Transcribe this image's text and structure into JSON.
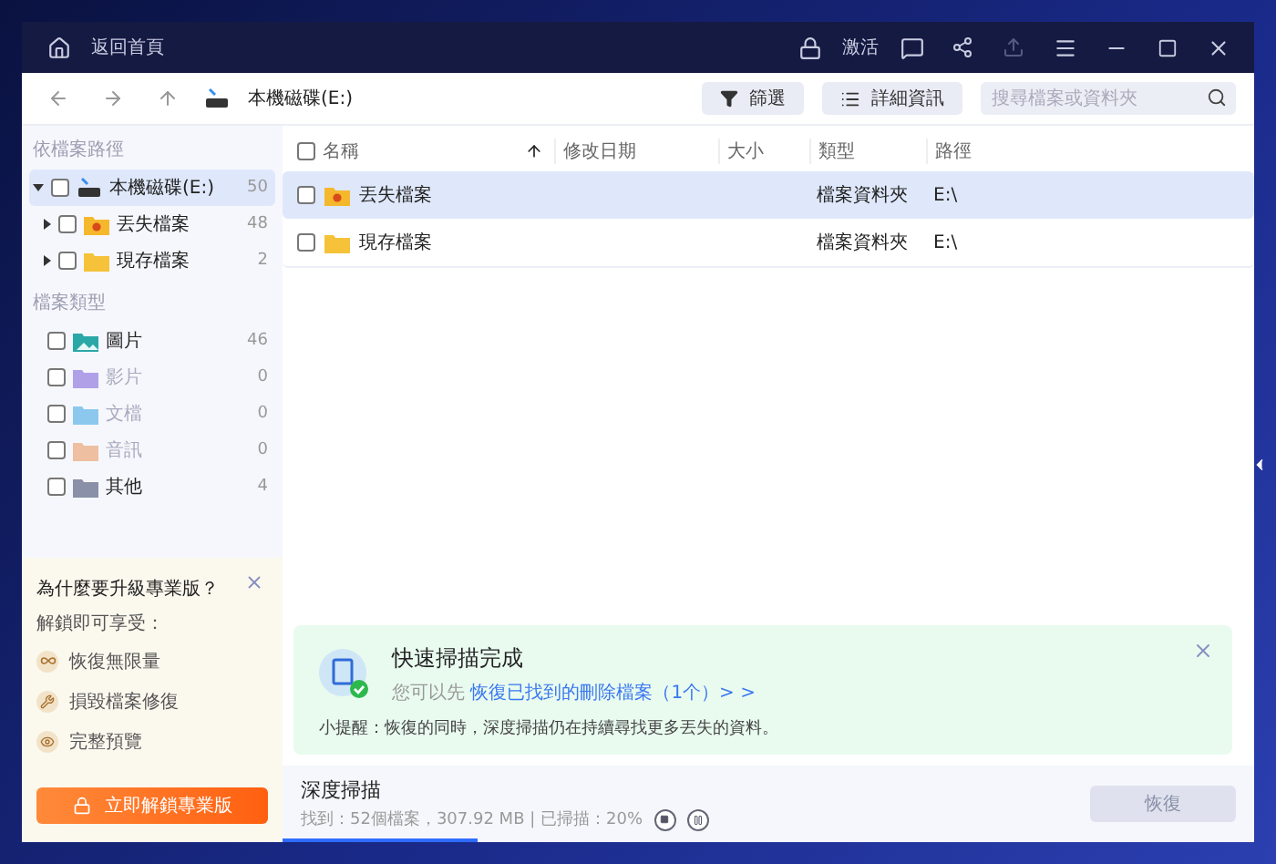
{
  "title_bar": {
    "home_label": "返回首頁",
    "activate_label": "激活"
  },
  "toolbar": {
    "location": "本機磁碟(E:)",
    "filter_label": "篩選",
    "details_label": "詳細資訊",
    "search_placeholder": "搜尋檔案或資料夾"
  },
  "sidebar": {
    "path_heading": "依檔案路徑",
    "tree": [
      {
        "label": "本機磁碟(E:)",
        "count": "50",
        "kind": "drive",
        "checked": false,
        "expanded": true,
        "selected": true,
        "children": [
          {
            "label": "丟失檔案",
            "count": "48",
            "kind": "lost",
            "checked": false,
            "expanded": false,
            "selected": false
          },
          {
            "label": "現存檔案",
            "count": "2",
            "kind": "folder",
            "checked": false,
            "expanded": false,
            "selected": false
          }
        ]
      }
    ],
    "type_heading": "檔案類型",
    "types": [
      {
        "label": "圖片",
        "count": "46",
        "kind": "image",
        "checked": false,
        "disabled": false
      },
      {
        "label": "影片",
        "count": "0",
        "kind": "video",
        "checked": false,
        "disabled": true
      },
      {
        "label": "文檔",
        "count": "0",
        "kind": "document",
        "checked": false,
        "disabled": true
      },
      {
        "label": "音訊",
        "count": "0",
        "kind": "audio",
        "checked": false,
        "disabled": true
      },
      {
        "label": "其他",
        "count": "4",
        "kind": "other",
        "checked": false,
        "disabled": false
      }
    ]
  },
  "upgrade": {
    "title": "為什麼要升級專業版？",
    "subtitle": "解鎖即可享受：",
    "features": [
      {
        "label": "恢復無限量",
        "kind": "infinite"
      },
      {
        "label": "損毀檔案修復",
        "kind": "repair"
      },
      {
        "label": "完整預覽",
        "kind": "preview"
      }
    ],
    "button": "立即解鎖專業版"
  },
  "table": {
    "columns": [
      {
        "label": "名稱",
        "sorted": true
      },
      {
        "label": "修改日期",
        "sorted": false
      },
      {
        "label": "大小",
        "sorted": false
      },
      {
        "label": "類型",
        "sorted": false
      },
      {
        "label": "路徑",
        "sorted": false
      }
    ],
    "rows": [
      {
        "name": "丟失檔案",
        "kind": "lost",
        "type": "檔案資料夾",
        "path": "E:\\",
        "selected": true,
        "checked": false
      },
      {
        "name": "現存檔案",
        "kind": "folder",
        "type": "檔案資料夾",
        "path": "E:\\",
        "selected": false,
        "checked": false
      }
    ]
  },
  "notice": {
    "title": "快速掃描完成",
    "prefix": "您可以先",
    "link": "恢復已找到的刪除檔案（1个）> >",
    "tip": "小提醒：恢復的同時，深度掃描仍在持續尋找更多丟失的資料。"
  },
  "scan": {
    "title": "深度掃描",
    "status": "找到：52個檔案，307.92 MB | 已掃描：20%",
    "level": 0.2,
    "recover_button": {
      "label": "恢復",
      "disabled": true
    }
  }
}
